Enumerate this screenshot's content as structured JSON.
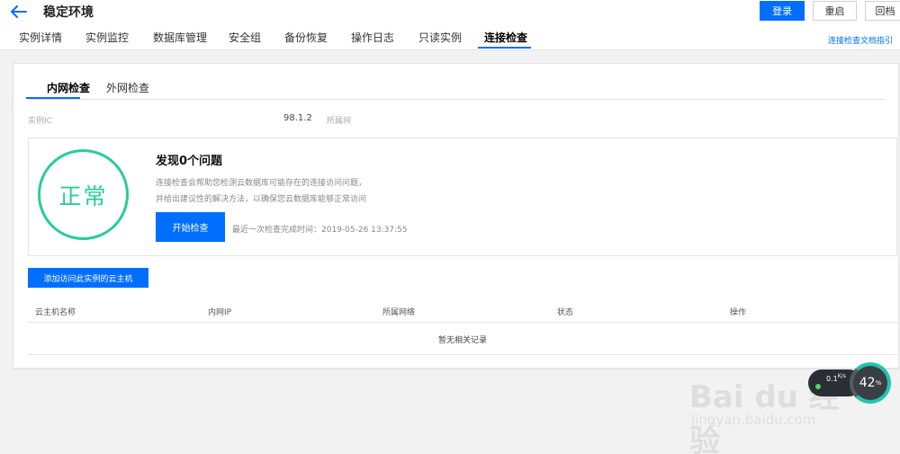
{
  "header": {
    "title": "稳定环境",
    "buttons": {
      "login": "登录",
      "restart": "重启",
      "rollback": "回档"
    }
  },
  "tabs": [
    {
      "label": "实例详情"
    },
    {
      "label": "实例监控"
    },
    {
      "label": "数据库管理"
    },
    {
      "label": "安全组"
    },
    {
      "label": "备份恢复"
    },
    {
      "label": "操作日志"
    },
    {
      "label": "只读实例"
    },
    {
      "label": "连接检查",
      "active": true
    }
  ],
  "doc_link": "连接检查文档指引",
  "subtabs": [
    {
      "label": "内网检查",
      "active": true
    },
    {
      "label": "外网检查"
    }
  ],
  "instance_info": {
    "instance_label": "实例IC",
    "ip_value": "98.1.2",
    "belongs_label": "所属网"
  },
  "check_result": {
    "status": "正常",
    "title": "发现0个问题",
    "desc_line1": "连接检查会帮助您检测云数据库可能存在的连接访问问题，",
    "desc_line2": "并给出建议性的解决方法，以确保您云数据库能够正常访问",
    "start_button": "开始检查",
    "last_check": "最近一次检查完成时间：2019-05-26 13:37:55",
    "status_color": "#29cc9a"
  },
  "add_host_button": "添加访问此实例的云主机",
  "table": {
    "columns": [
      "云主机名称",
      "内网IP",
      "所属网络",
      "状态",
      "操作"
    ],
    "empty_text": "暂无相关记录"
  },
  "overlay": {
    "speed": "0.1",
    "speed_unit": "K/s",
    "percent": "42",
    "percent_unit": "%"
  },
  "watermark": {
    "logo": "Bai du 经验",
    "url": "jingyan.baidu.com"
  },
  "colors": {
    "accent": "#006eff",
    "success": "#29cc9a"
  }
}
